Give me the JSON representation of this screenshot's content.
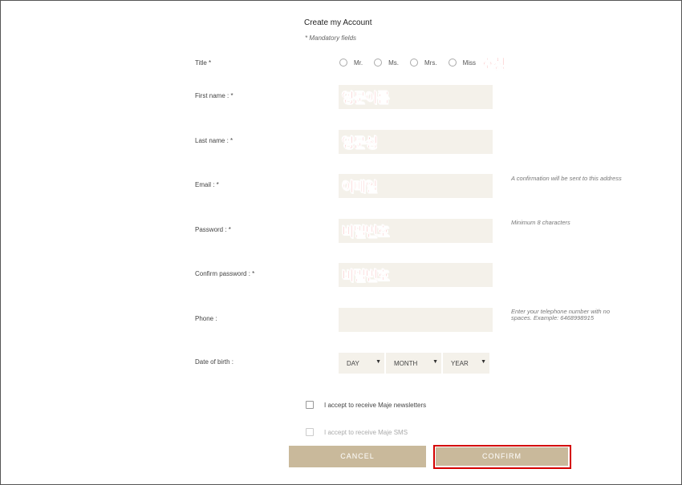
{
  "form": {
    "title": "Create my Account",
    "mandatory_note": "* Mandatory fields"
  },
  "fields": {
    "title_label": "Title *",
    "title_options": [
      "Mr.",
      "Ms.",
      "Mrs.",
      "Miss"
    ],
    "first_name_label": "First name : *",
    "last_name_label": "Last name : *",
    "email_label": "Email : *",
    "email_hint": "A confirmation will be sent to this address",
    "password_label": "Password : *",
    "password_hint": "Minimum 8 characters",
    "confirm_password_label": "Confirm password : *",
    "phone_label": "Phone :",
    "phone_hint_line1": "Enter your telephone number with no",
    "phone_hint_line2": "spaces. Example: 6468998915",
    "dob_label": "Date of birth :",
    "dob_day": "DAY",
    "dob_month": "MONTH",
    "dob_year": "YEAR"
  },
  "annotations": {
    "title": "호칭",
    "first_name": "영문이름",
    "last_name": "영문성",
    "email": "이메일",
    "password": "비밀번호",
    "confirm_password": "비밀번호"
  },
  "checkboxes": {
    "newsletter": "I accept to receive Maje newsletters",
    "sms": "I accept to receive Maje SMS"
  },
  "buttons": {
    "cancel": "CANCEL",
    "confirm": "CONFIRM"
  },
  "colors": {
    "accent": "#c9b99b",
    "input_bg": "#f4f1ea",
    "annotation": "#e60000",
    "highlight_border": "#d40000"
  }
}
